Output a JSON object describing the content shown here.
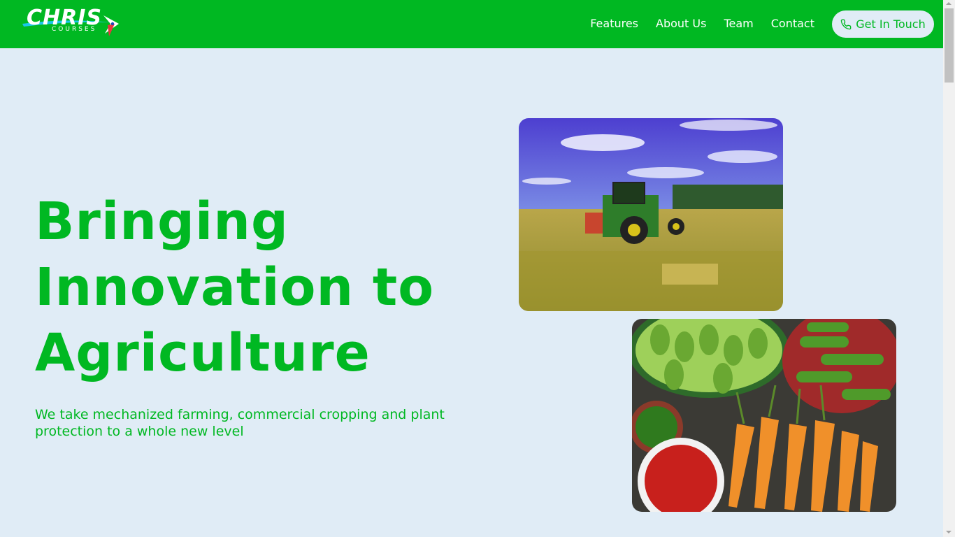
{
  "brand": {
    "name": "CHRIS",
    "tagline": "COURSES"
  },
  "nav": {
    "links": [
      "Features",
      "About Us",
      "Team",
      "Contact"
    ],
    "cta_label": "Get In Touch",
    "cta_icon": "phone-icon"
  },
  "hero": {
    "title": "Bringing Innovation to Agriculture",
    "subtitle": "We take mechanized farming, commercial cropping and plant protection to a whole new level"
  },
  "images": {
    "tractor": "tractor-field-photo",
    "vegetables": "vegetables-market-photo"
  },
  "colors": {
    "brand_green": "#00b822",
    "background": "#e0ecf6",
    "text_on_brand": "#ffffff"
  }
}
